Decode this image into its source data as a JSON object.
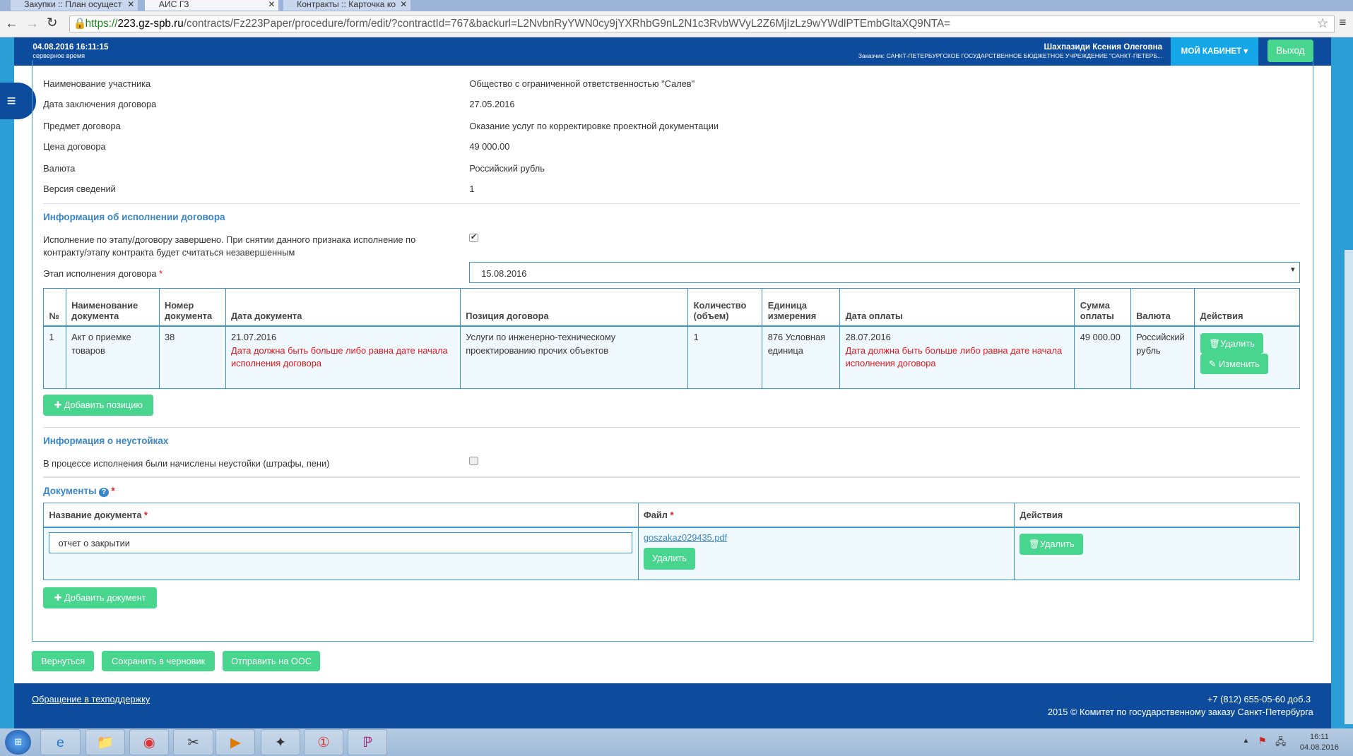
{
  "browser": {
    "tabs": [
      {
        "label": "Закупки :: План осущест"
      },
      {
        "label": "АИС ГЗ"
      },
      {
        "label": "Контракты :: Карточка ко"
      }
    ],
    "url_scheme": "https://",
    "url_host": "223.gz-spb.ru",
    "url_path": "/contracts/Fz223Paper/procedure/form/edit/?contractId=767&backurl=L2NvbnRyYWN0cy9jYXRhbG9nL2N1c3RvbWVyL2Z6MjIzLz9wYWdlPTEmbGltaXQ9NTA="
  },
  "header": {
    "datetime": "04.08.2016 16:11:15",
    "server_time_label": "серверное время",
    "user_name": "Шахпазиди Ксения Олеговна",
    "customer": "Заказчик: САНКТ-ПЕТЕРБУРГСКОЕ ГОСУДАРСТВЕННОЕ БЮДЖЕТНОЕ УЧРЕЖДЕНИЕ \"САНКТ-ПЕТЕРБ...",
    "cabinet_label": "МОЙ КАБИНЕТ",
    "logout_label": "Выход"
  },
  "info": [
    {
      "label": "Наименование участника",
      "value": "Общество с ограниченной ответственностью \"Салев\""
    },
    {
      "label": "Дата заключения договора",
      "value": "27.05.2016"
    },
    {
      "label": "Предмет договора",
      "value": "Оказание услуг по корректировке проектной документации"
    },
    {
      "label": "Цена договора",
      "value": "49 000.00"
    },
    {
      "label": "Валюта",
      "value": "Российский рубль"
    },
    {
      "label": "Версия сведений",
      "value": "1"
    }
  ],
  "execution": {
    "heading": "Информация об исполнении договора",
    "completed_label_1": "Исполнение по этапу/договору завершено. При снятии данного признака исполнение по",
    "completed_label_2": "контракту/этапу контракта будет считаться незавершенным",
    "completed_checked": true,
    "stage_label": "Этап исполнения договора",
    "stage_value": "15.08.2016",
    "columns": [
      "№",
      "Наименование документа",
      "Номер документа",
      "Дата документа",
      "Позиция договора",
      "Количество (объем)",
      "Единица измерения",
      "Дата оплаты",
      "Сумма оплаты",
      "Валюта",
      "Действия"
    ],
    "rows": [
      {
        "n": "1",
        "doc_name": "Акт о приемке товаров",
        "doc_number": "38",
        "doc_date": "21.07.2016",
        "doc_date_error": "Дата должна быть больше либо равна дате начала исполнения договора",
        "position": "Услуги по инженерно-техническому проектированию прочих объектов",
        "qty": "1",
        "unit": "876 Условная единица",
        "pay_date": "28.07.2016",
        "pay_date_error": "Дата должна быть больше либо равна дате начала исполнения договора",
        "sum": "49 000.00",
        "currency": "Российский рубль",
        "delete_label": "Удалить",
        "edit_label": "Изменить"
      }
    ],
    "add_position_label": "Добавить позицию"
  },
  "penalties": {
    "heading": "Информация о неустойках",
    "label": "В процессе исполнения были начислены неустойки (штрафы, пени)",
    "checked": false
  },
  "documents": {
    "heading": "Документы",
    "columns": [
      "Название документа",
      "Файл",
      "Действия"
    ],
    "rows": [
      {
        "name": "отчет о закрытии",
        "file": "goszakaz029435.pdf",
        "file_delete_label": "Удалить",
        "delete_label": "Удалить"
      }
    ],
    "add_label": "Добавить документ"
  },
  "actions": {
    "back": "Вернуться",
    "save_draft": "Сохранить в черновик",
    "send": "Отправить на ООС"
  },
  "footer": {
    "support_link": "Обращение в техподдержку",
    "phone": "+7 (812) 655-05-60 доб.3",
    "copyright": "2015 © Комитет по государственному заказу Санкт-Петербурга"
  },
  "taskbar": {
    "time": "16:11",
    "date": "04.08.2016"
  },
  "colors": {
    "header": "#0d4c9c",
    "accent": "#2a9ed5",
    "button": "#48d58d",
    "error": "#e3161c",
    "heading": "#3a86c8"
  }
}
